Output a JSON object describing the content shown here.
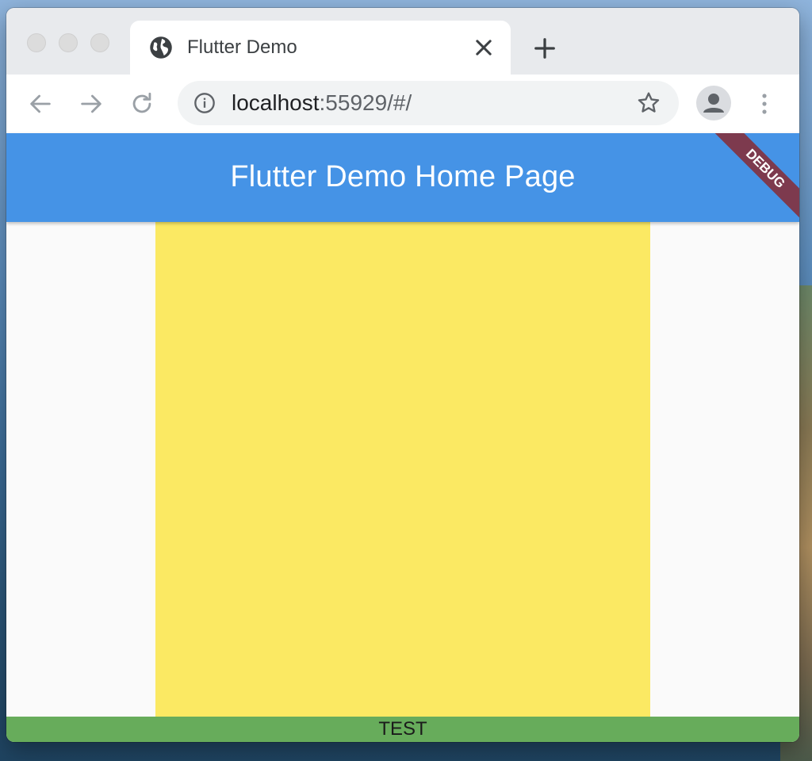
{
  "browser": {
    "tab": {
      "title": "Flutter Demo",
      "favicon": "globe-icon"
    },
    "address_bar": {
      "host": "localhost",
      "rest": ":55929/#/"
    },
    "icons": [
      "back-arrow-icon",
      "forward-arrow-icon",
      "reload-icon",
      "info-icon",
      "star-icon",
      "profile-icon",
      "menu-icon",
      "close-icon",
      "plus-icon"
    ]
  },
  "app": {
    "appbar_title": "Flutter Demo Home Page",
    "debug_banner": "DEBUG",
    "footer_text": "TEST",
    "colors": {
      "appbar": "#4593e6",
      "box": "#fbe963",
      "footer": "#67ac5b",
      "banner": "#7d3a4e",
      "background": "#fafafa"
    }
  }
}
